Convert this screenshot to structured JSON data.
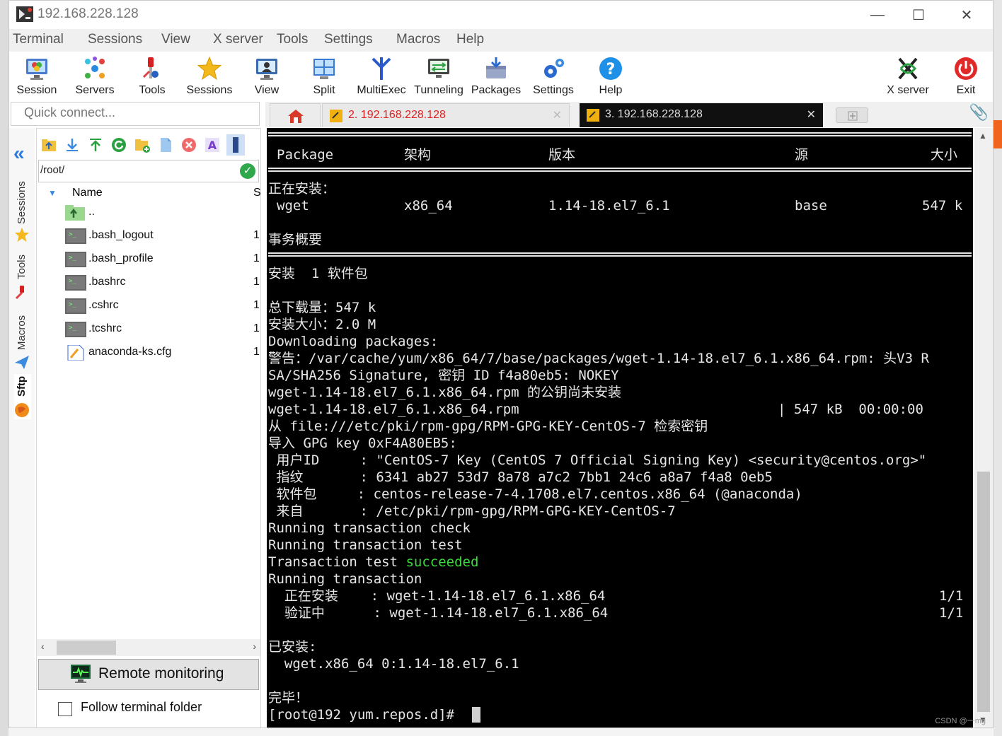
{
  "window": {
    "title": "192.168.228.128"
  },
  "menu": [
    "Terminal",
    "Sessions",
    "View",
    "X server",
    "Tools",
    "Settings",
    "Macros",
    "Help"
  ],
  "toolbar": {
    "items": [
      "Session",
      "Servers",
      "Tools",
      "Sessions",
      "View",
      "Split",
      "MultiExec",
      "Tunneling",
      "Packages",
      "Settings",
      "Help"
    ],
    "xserver": "X server",
    "exit": "Exit"
  },
  "quick_connect": {
    "placeholder": "Quick connect..."
  },
  "tabs": [
    {
      "label": "2. 192.168.228.128"
    },
    {
      "label": "3. 192.168.228.128"
    }
  ],
  "side_tabs": {
    "sessions": "Sessions",
    "tools": "Tools",
    "macros": "Macros",
    "sftp": "Sftp"
  },
  "sftp": {
    "path": "/root/",
    "col_name": "Name",
    "col_size": "S",
    "files": [
      {
        "name": "..",
        "size": ""
      },
      {
        "name": ".bash_logout",
        "size": "1"
      },
      {
        "name": ".bash_profile",
        "size": "1"
      },
      {
        "name": ".bashrc",
        "size": "1"
      },
      {
        "name": ".cshrc",
        "size": "1"
      },
      {
        "name": ".tcshrc",
        "size": "1"
      },
      {
        "name": "anaconda-ks.cfg",
        "size": "1"
      }
    ],
    "remote_monitoring": "Remote monitoring",
    "follow_folder": "Follow terminal folder"
  },
  "terminal": {
    "header": [
      "Package",
      "架构",
      "版本",
      "源",
      "大小"
    ],
    "installing_label": "正在安装：",
    "pkg_row": [
      "wget",
      "x86_64",
      "1.14-18.el7_6.1",
      "base",
      "547 k"
    ],
    "summary_title": "事务概要",
    "line_install": "安装  1 软件包",
    "line_total": "总下载量：547 k",
    "line_size": "安装大小：2.0 M",
    "line_dl": "Downloading packages:",
    "line_warn1": "警告：/var/cache/yum/x86_64/7/base/packages/wget-1.14-18.el7_6.1.x86_64.rpm: 头V3 R",
    "line_warn2": "SA/SHA256 Signature, 密钥 ID f4a80eb5: NOKEY",
    "line_pubkey": "wget-1.14-18.el7_6.1.x86_64.rpm 的公钥尚未安装",
    "line_rpm": "wget-1.14-18.el7_6.1.x86_64.rpm",
    "line_rpm_stats": "| 547 kB  00:00:00",
    "line_from": "从 file:///etc/pki/rpm-gpg/RPM-GPG-KEY-CentOS-7 检索密钥",
    "line_import": "导入 GPG key 0xF4A80EB5:",
    "line_uid": " 用户ID     : \"CentOS-7 Key (CentOS 7 Official Signing Key) <security@centos.org>\"",
    "line_fp": " 指纹       : 6341 ab27 53d7 8a78 a7c2 7bb1 24c6 a8a7 f4a8 0eb5",
    "line_pkg": " 软件包     : centos-release-7-4.1708.el7.centos.x86_64 (@anaconda)",
    "line_src": " 来自       : /etc/pki/rpm-gpg/RPM-GPG-KEY-CentOS-7",
    "line_rtc": "Running transaction check",
    "line_rtt": "Running transaction test",
    "line_tt_prefix": "Transaction test ",
    "line_tt_ok": "succeeded",
    "line_rt": "Running transaction",
    "line_inst": "  正在安装    : wget-1.14-18.el7_6.1.x86_64",
    "line_inst_n": "1/1",
    "line_verify": "  验证中      : wget-1.14-18.el7_6.1.x86_64",
    "line_verify_n": "1/1",
    "line_installed": "已安装:",
    "line_installed_pkg": "  wget.x86_64 0:1.14-18.el7_6.1",
    "line_done": "完毕！",
    "prompt": "[root@192 yum.repos.d]# "
  },
  "watermark": "CSDN @一mg",
  "colors": {
    "success": "#3ddc3d",
    "tab_active_bg": "#101010",
    "tab2_text": "#e02020"
  }
}
